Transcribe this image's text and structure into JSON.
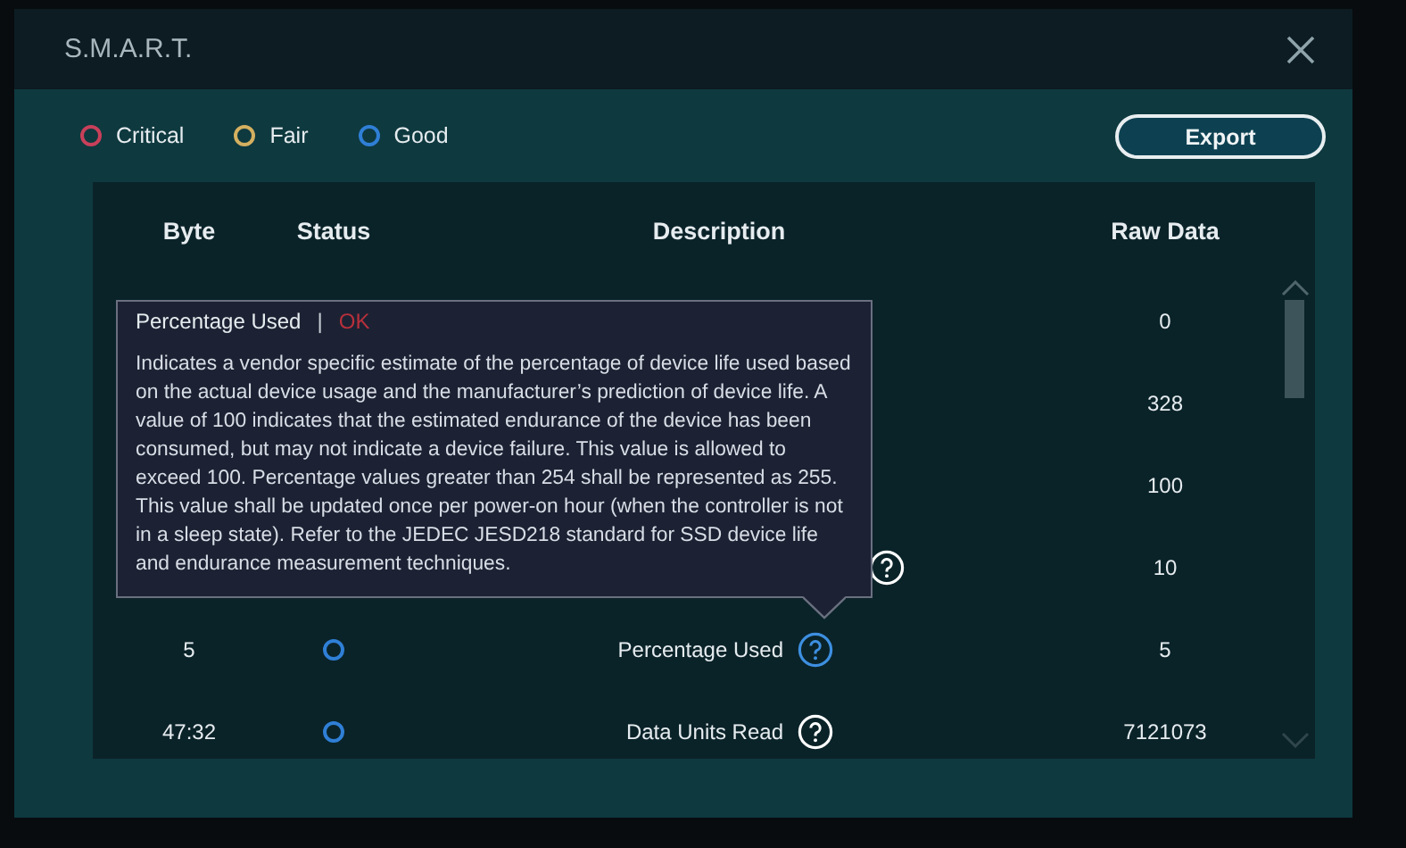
{
  "dialog": {
    "title": "S.M.A.R.T."
  },
  "legend": [
    {
      "label": "Critical",
      "color": "#c8405a"
    },
    {
      "label": "Fair",
      "color": "#d4b060"
    },
    {
      "label": "Good",
      "color": "#2f7fd6"
    }
  ],
  "export_button": "Export",
  "table": {
    "columns": [
      "Byte",
      "Status",
      "Description",
      "Raw Data"
    ],
    "rows": [
      {
        "raw_data": "0"
      },
      {
        "raw_data": "328"
      },
      {
        "raw_data": "100"
      },
      {
        "raw_data": "10",
        "help_selected": false
      },
      {
        "byte": "5",
        "color": "#2f7fd6",
        "description": "Percentage Used",
        "raw_data": "5",
        "help_selected": true
      },
      {
        "byte": "47:32",
        "color": "#2f7fd6",
        "description": "Data Units Read",
        "raw_data": "7121073",
        "help_selected": false
      }
    ]
  },
  "tooltip": {
    "title": "Percentage Used",
    "separator": "|",
    "status": "OK",
    "text": "Indicates a vendor specific estimate of the percentage of device life used based on the actual device usage and the manufacturer’s prediction of device life. A value of 100 indicates that the estimated endurance of the device has been consumed, but may not indicate a device failure. This value is allowed to exceed 100. Percentage values greater than 254 shall be represented as 255. This value shall be updated once per power-on hour (when the controller is not in a sleep state). Refer to the JEDEC JESD218 standard for SSD device life and endurance measurement techniques."
  }
}
